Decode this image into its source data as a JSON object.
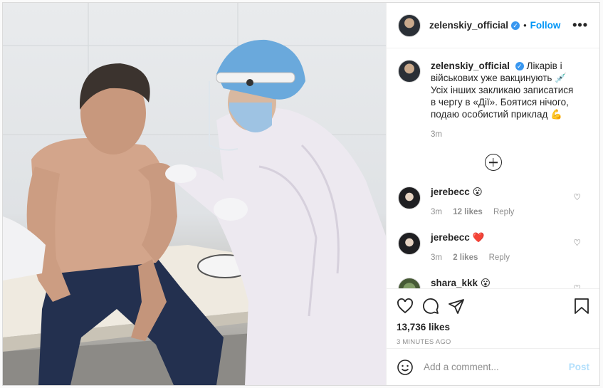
{
  "header": {
    "username": "zelenskiy_official",
    "separator": "•",
    "follow_label": "Follow",
    "more_label": "•••"
  },
  "caption": {
    "username": "zelenskiy_official",
    "text": "Лікарів і військових уже вакцинують 💉 Усіх інших закликаю записатися в чергу в «Дії». Боятися нічого, подаю особистий приклад 💪",
    "time": "3m"
  },
  "comments": [
    {
      "username": "jerebecc",
      "text": "😮",
      "time": "3m",
      "likes": "12 likes",
      "reply": "Reply"
    },
    {
      "username": "jerebecc",
      "text": "❤️",
      "time": "3m",
      "likes": "2 likes",
      "reply": "Reply"
    },
    {
      "username": "shara_kkk",
      "text": "😮",
      "time": "",
      "likes": "",
      "reply": ""
    }
  ],
  "footer": {
    "likes_count": "13,736 likes",
    "time_ago": "3 MINUTES AGO",
    "comment_placeholder": "Add a comment...",
    "post_label": "Post"
  },
  "icons": {
    "verified": "verified-badge-icon",
    "heart": "heart-icon",
    "comment": "comment-icon",
    "share": "share-icon",
    "bookmark": "bookmark-icon",
    "emoji": "emoji-icon",
    "load_more": "plus-circle-icon"
  },
  "colors": {
    "accent": "#0095f6",
    "verified": "#3897f0",
    "muted": "#8e8e8e",
    "post_disabled": "#b2dffc"
  }
}
